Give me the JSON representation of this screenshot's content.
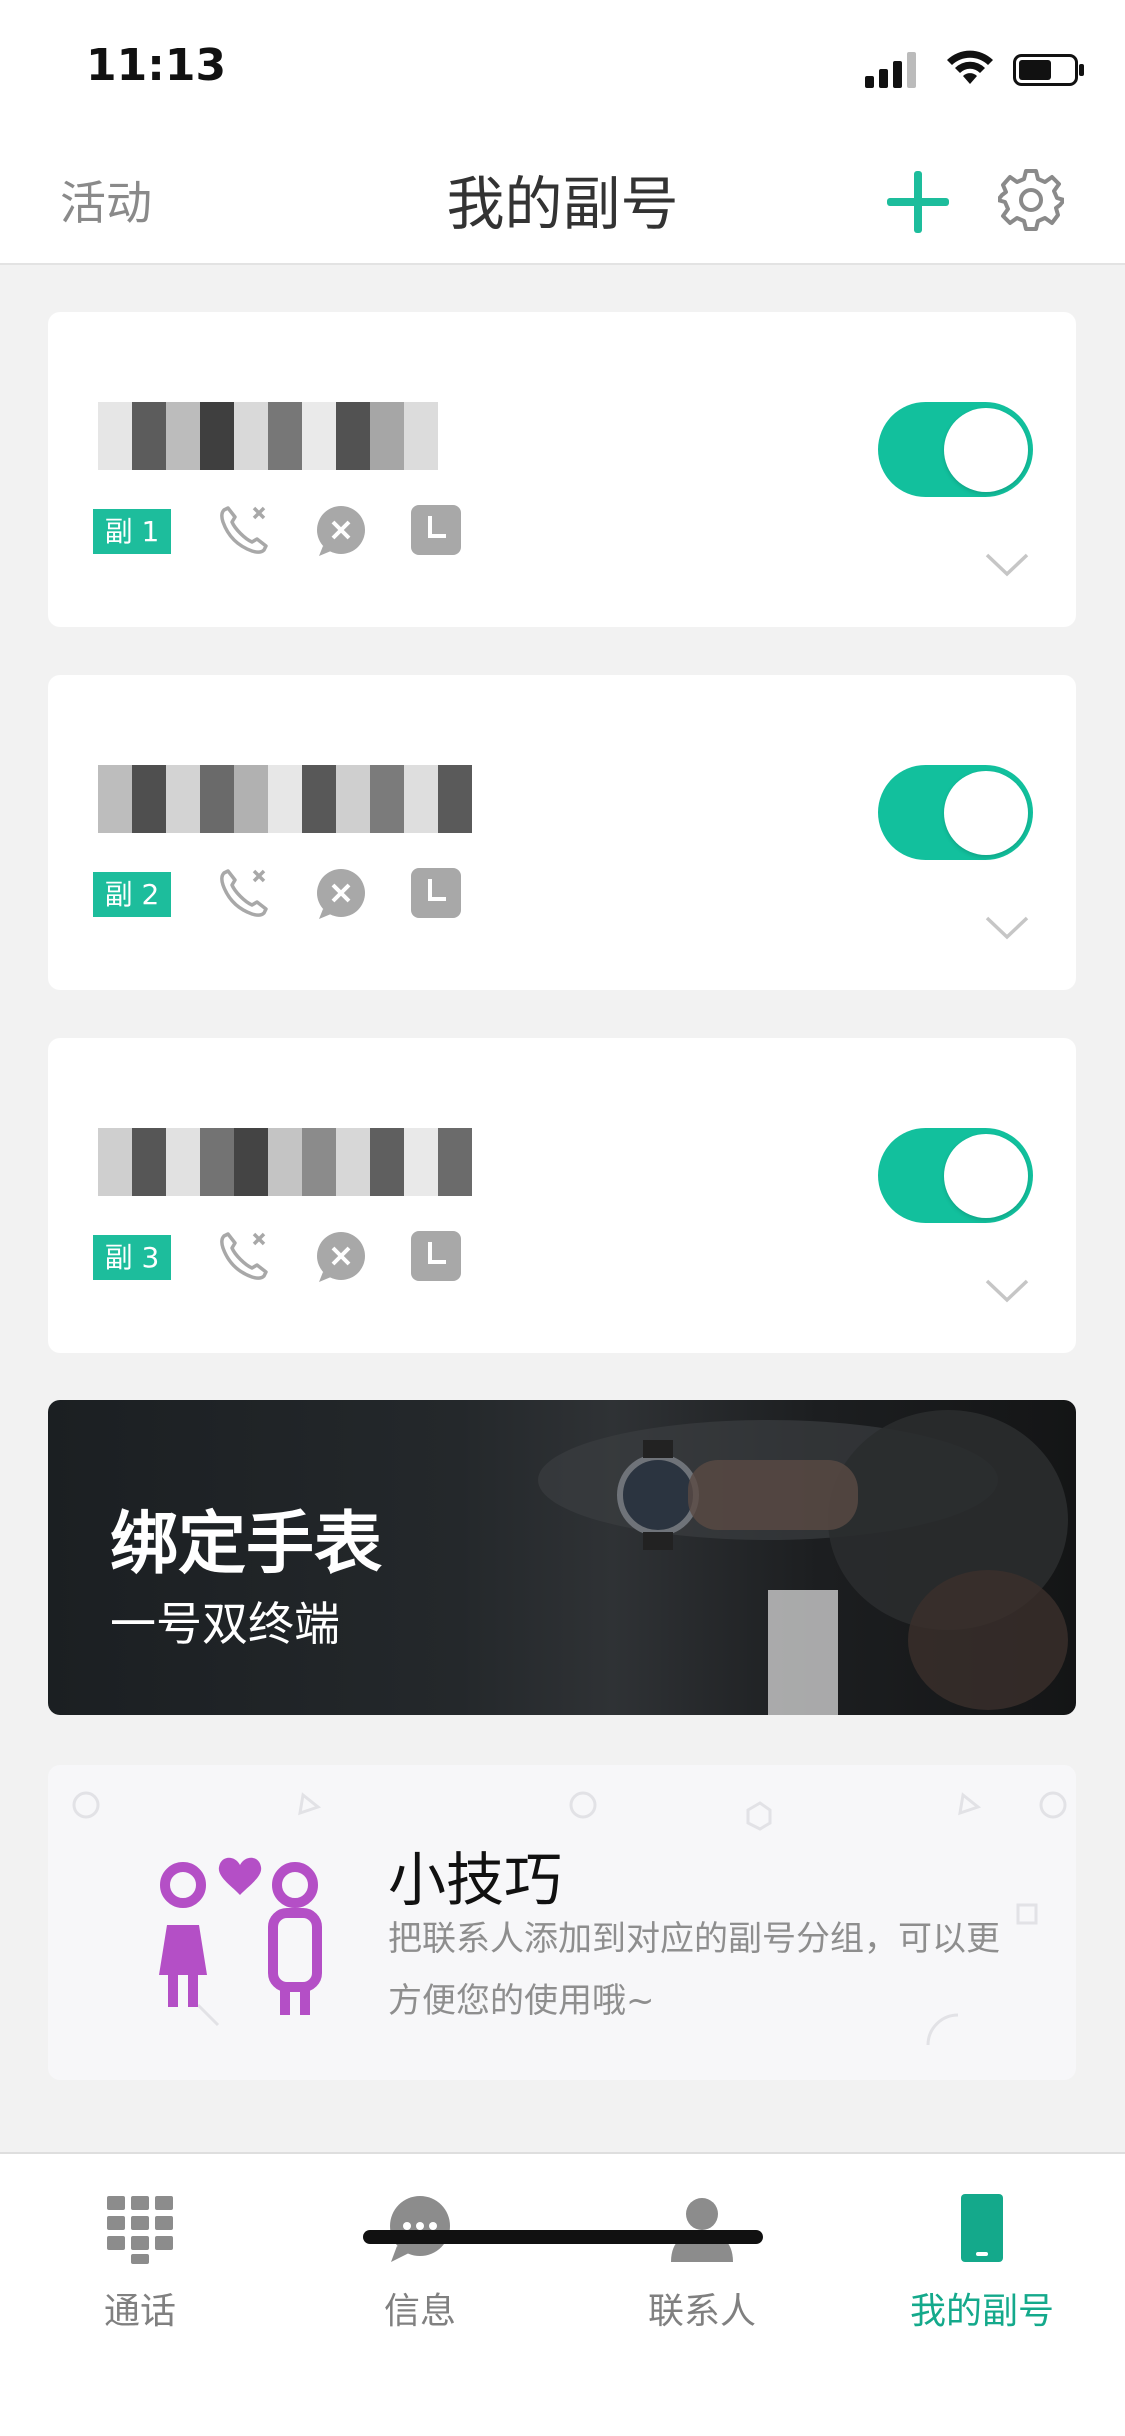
{
  "status_bar": {
    "time": "11:13"
  },
  "header": {
    "left_label": "活动",
    "title": "我的副号"
  },
  "cards": [
    {
      "tag": "副 1",
      "enabled": true
    },
    {
      "tag": "副 2",
      "enabled": true
    },
    {
      "tag": "副 3",
      "enabled": true
    }
  ],
  "banner": {
    "title": "绑定手表",
    "subtitle": "一号双终端"
  },
  "tips": {
    "title": "小技巧",
    "body": "把联系人添加到对应的副号分组，可以更方便您的使用哦~"
  },
  "tabs": [
    {
      "label": "通话",
      "icon": "dialpad-icon"
    },
    {
      "label": "信息",
      "icon": "chat-bubble-icon"
    },
    {
      "label": "联系人",
      "icon": "person-icon"
    },
    {
      "label": "我的副号",
      "icon": "phone-device-icon",
      "active": true
    }
  ],
  "colors": {
    "accent": "#1dbd9c",
    "toggle_on": "#12c09d",
    "tips_purple": "#b44fc6",
    "active_tab": "#14a98b"
  }
}
